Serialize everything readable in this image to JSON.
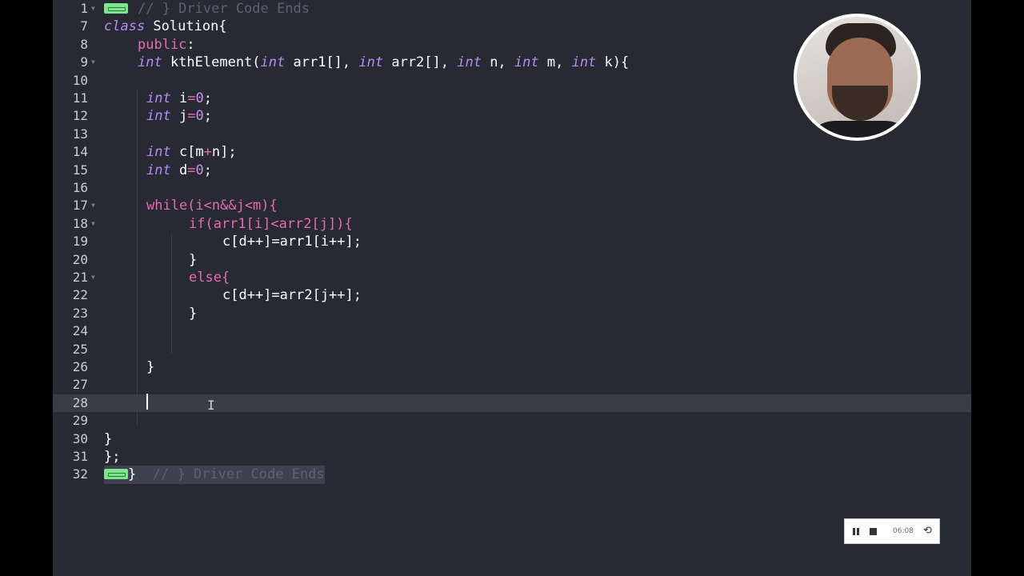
{
  "editor": {
    "lines": [
      {
        "num": "1",
        "top_comment": "// } Driver Code Ends"
      },
      {
        "num": "7",
        "kw": "class",
        "text": " Solution{"
      },
      {
        "num": "8",
        "access": "public",
        "text": ":"
      },
      {
        "num": "9",
        "signature": [
          "int",
          " kthElement(",
          "int",
          " arr1[], ",
          "int",
          " arr2[], ",
          "int",
          " n, ",
          "int",
          " m, ",
          "int",
          " k){"
        ]
      },
      {
        "num": "10"
      },
      {
        "num": "11",
        "decl": [
          "int",
          " i",
          "=",
          "0",
          ";"
        ]
      },
      {
        "num": "12",
        "decl": [
          "int",
          " j",
          "=",
          "0",
          ";"
        ]
      },
      {
        "num": "13"
      },
      {
        "num": "14",
        "decl": [
          "int",
          " c[m",
          "+",
          "n];",
          ""
        ]
      },
      {
        "num": "15",
        "decl": [
          "int",
          " d",
          "=",
          "0",
          ";"
        ]
      },
      {
        "num": "16"
      },
      {
        "num": "17",
        "code": "while(i<n&&j<m){"
      },
      {
        "num": "18",
        "code": "if(arr1[i]<arr2[j]){"
      },
      {
        "num": "19",
        "code": "c[d++]=arr1[i++];"
      },
      {
        "num": "20",
        "code": "}"
      },
      {
        "num": "21",
        "code": "else{"
      },
      {
        "num": "22",
        "code": "c[d++]=arr2[j++];"
      },
      {
        "num": "23",
        "code": "}"
      },
      {
        "num": "24"
      },
      {
        "num": "25"
      },
      {
        "num": "26",
        "code": "}"
      },
      {
        "num": "27"
      },
      {
        "num": "28"
      },
      {
        "num": "29"
      },
      {
        "num": "30",
        "code": "}"
      },
      {
        "num": "31",
        "code": "};"
      },
      {
        "num": "32",
        "brace": "}",
        "bottom_comment": "// } Driver Code Ends"
      }
    ]
  },
  "recorder": {
    "time": "06:08",
    "reset_icon": "⟲"
  }
}
